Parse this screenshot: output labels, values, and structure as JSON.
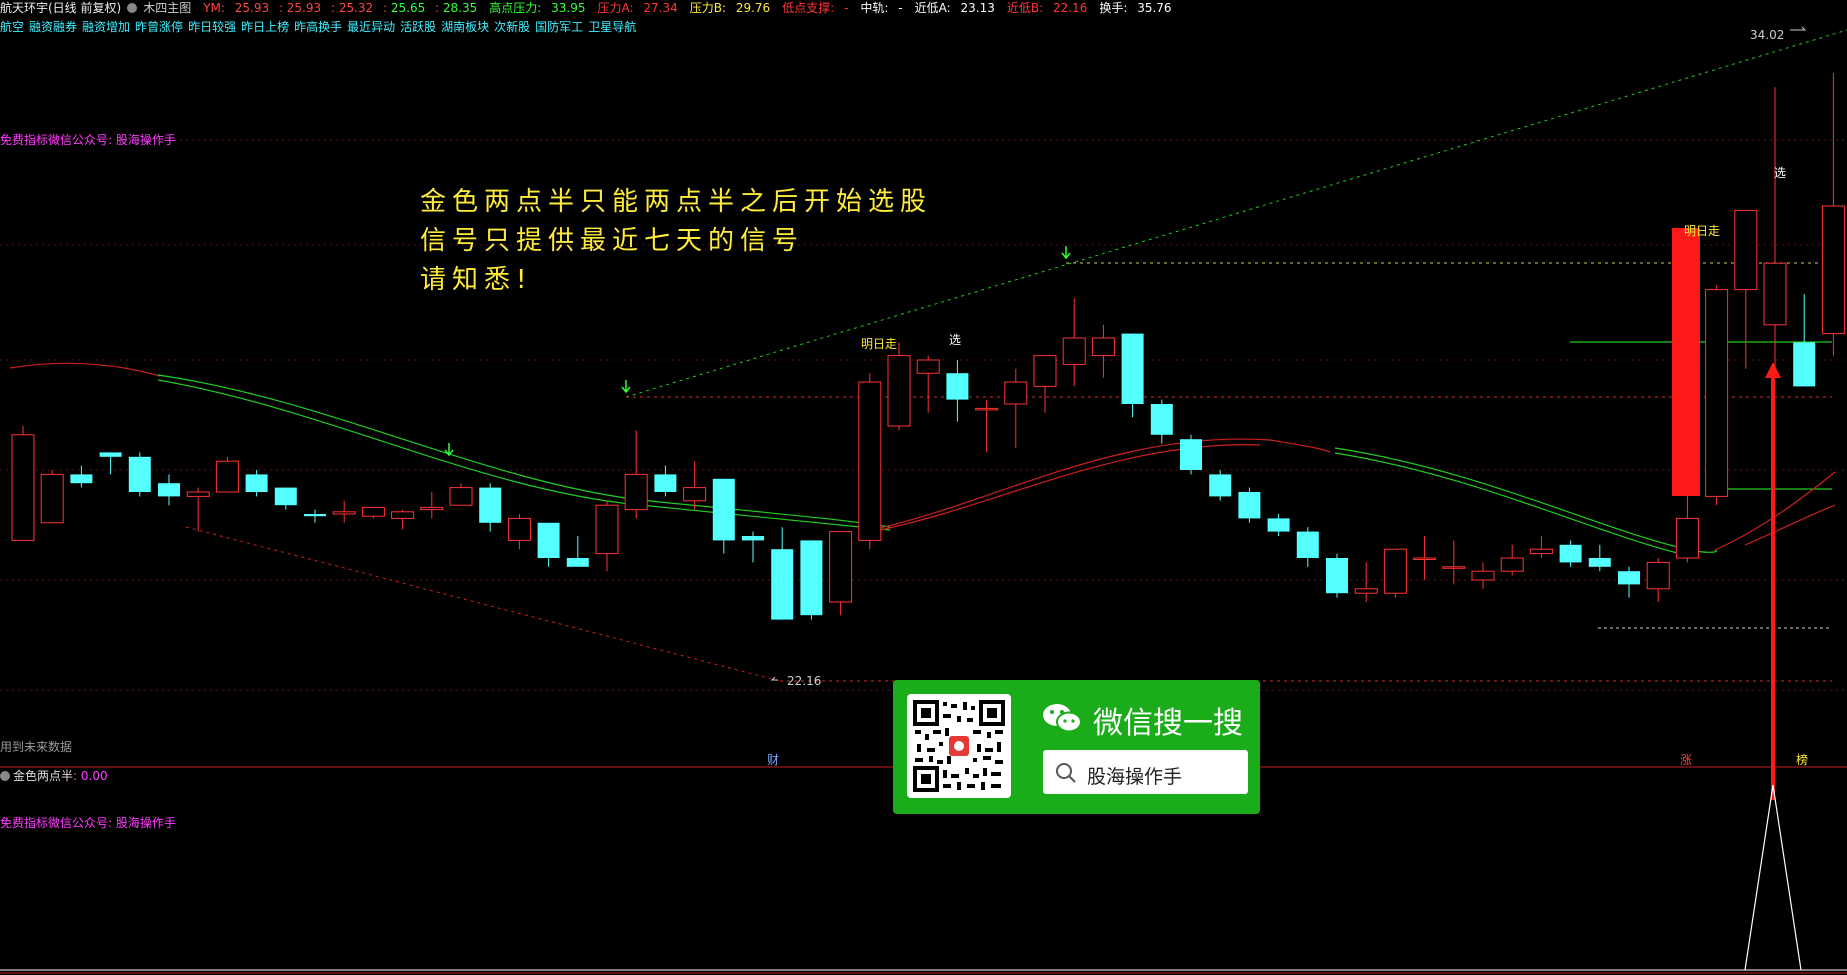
{
  "header": {
    "stock": "航天环宇(日线 前复权)",
    "indicator": "木四主图",
    "ym_label": "YM:",
    "ym_values": [
      "25.93",
      "25.93",
      "25.32",
      "25.65",
      "28.35"
    ],
    "items": [
      {
        "label": "高点压力:",
        "value": "33.95",
        "color": "#33ff33"
      },
      {
        "label": "压力A:",
        "value": "27.34",
        "color": "#ff3333"
      },
      {
        "label": "压力B:",
        "value": "29.76",
        "color": "#ffeb3b"
      },
      {
        "label": "低点支撑:",
        "value": "-",
        "color": "#ff3333"
      },
      {
        "label": "中轨:",
        "value": "-",
        "color": "#ffffff"
      },
      {
        "label": "近低A:",
        "value": "23.13",
        "color": "#ffffff"
      },
      {
        "label": "近低B:",
        "value": "22.16",
        "color": "#ff3333"
      },
      {
        "label": "换手:",
        "value": "35.76",
        "color": "#ffffff"
      }
    ]
  },
  "tags": [
    "航空",
    "融资融券",
    "融资增加",
    "昨曾涨停",
    "昨日较强",
    "昨日上榜",
    "昨高换手",
    "最近异动",
    "活跃股",
    "湖南板块",
    "次新股",
    "国防军工",
    "卫星导航"
  ],
  "promo_top": "免费指标微信公众号: 股海操作手",
  "promo_bottom": "免费指标微信公众号: 股海操作手",
  "notice": [
    "金色两点半只能两点半之后开始选股",
    "信号只提供最近七天的信号",
    "请知悉!"
  ],
  "future_note": "用到未来数据",
  "sub_indicator": {
    "name": "金色两点半",
    "value": ": 0.00"
  },
  "markers": {
    "tomorrow1": "明日走",
    "tomorrow2": "明日走",
    "select1": "选",
    "select2": "选",
    "price_high": "34.02",
    "price_low": "22.16",
    "cai": "财",
    "zhang": "涨",
    "bang": "榜"
  },
  "wechat": {
    "title": "微信搜一搜",
    "search_text": "股海操作手"
  },
  "chart_data": {
    "type": "candlestick",
    "y_range": [
      20.0,
      35.0
    ],
    "candles": [
      {
        "o": 23.4,
        "h": 26.0,
        "l": 24.8,
        "c": 25.8
      },
      {
        "o": 23.8,
        "h": 25.0,
        "l": 24.7,
        "c": 24.9
      },
      {
        "o": 24.9,
        "h": 25.1,
        "l": 24.6,
        "c": 24.7
      },
      {
        "o": 25.4,
        "h": 25.4,
        "l": 24.9,
        "c": 25.3
      },
      {
        "o": 25.3,
        "h": 25.4,
        "l": 24.4,
        "c": 24.5
      },
      {
        "o": 24.7,
        "h": 24.9,
        "l": 24.2,
        "c": 24.4
      },
      {
        "o": 24.4,
        "h": 24.6,
        "l": 23.6,
        "c": 24.5
      },
      {
        "o": 24.5,
        "h": 25.3,
        "l": 24.5,
        "c": 25.2
      },
      {
        "o": 24.9,
        "h": 25.0,
        "l": 24.4,
        "c": 24.5
      },
      {
        "o": 24.6,
        "h": 24.6,
        "l": 24.1,
        "c": 24.2
      },
      {
        "o": 24.0,
        "h": 24.1,
        "l": 23.8,
        "c": 23.95
      },
      {
        "o": 24.0,
        "h": 24.3,
        "l": 23.8,
        "c": 24.05
      },
      {
        "o": 23.95,
        "h": 24.15,
        "l": 23.9,
        "c": 24.15
      },
      {
        "o": 23.9,
        "h": 24.1,
        "l": 23.65,
        "c": 24.05
      },
      {
        "o": 24.1,
        "h": 24.5,
        "l": 23.9,
        "c": 24.15
      },
      {
        "o": 24.2,
        "h": 24.7,
        "l": 24.2,
        "c": 24.6
      },
      {
        "o": 24.6,
        "h": 24.7,
        "l": 23.6,
        "c": 23.8
      },
      {
        "o": 23.4,
        "h": 24.0,
        "l": 23.2,
        "c": 23.9
      },
      {
        "o": 23.8,
        "h": 23.8,
        "l": 22.8,
        "c": 23.0
      },
      {
        "o": 23.0,
        "h": 23.5,
        "l": 22.8,
        "c": 22.8
      },
      {
        "o": 23.1,
        "h": 24.3,
        "l": 22.7,
        "c": 24.2
      },
      {
        "o": 24.1,
        "h": 25.9,
        "l": 23.9,
        "c": 24.9
      },
      {
        "o": 24.9,
        "h": 25.1,
        "l": 24.4,
        "c": 24.5
      },
      {
        "o": 24.3,
        "h": 25.2,
        "l": 24.1,
        "c": 24.6
      },
      {
        "o": 24.8,
        "h": 24.8,
        "l": 23.1,
        "c": 23.4
      },
      {
        "o": 23.5,
        "h": 23.6,
        "l": 22.9,
        "c": 23.4
      },
      {
        "o": 23.2,
        "h": 23.7,
        "l": 22.2,
        "c": 21.6
      },
      {
        "o": 23.4,
        "h": 23.4,
        "l": 21.6,
        "c": 21.7
      },
      {
        "o": 22.0,
        "h": 23.6,
        "l": 21.7,
        "c": 23.6
      },
      {
        "o": 23.4,
        "h": 27.2,
        "l": 23.2,
        "c": 27.0
      },
      {
        "o": 26.0,
        "h": 27.9,
        "l": 25.9,
        "c": 27.6
      },
      {
        "o": 27.2,
        "h": 27.6,
        "l": 26.3,
        "c": 27.5
      },
      {
        "o": 27.2,
        "h": 27.5,
        "l": 26.1,
        "c": 26.6
      },
      {
        "o": 26.4,
        "h": 26.6,
        "l": 25.4,
        "c": 26.4
      },
      {
        "o": 26.5,
        "h": 27.3,
        "l": 25.5,
        "c": 27.0
      },
      {
        "o": 26.9,
        "h": 27.6,
        "l": 26.3,
        "c": 27.6
      },
      {
        "o": 27.4,
        "h": 28.9,
        "l": 26.9,
        "c": 28.0
      },
      {
        "o": 27.6,
        "h": 28.3,
        "l": 27.1,
        "c": 28.0
      },
      {
        "o": 28.1,
        "h": 28.1,
        "l": 26.2,
        "c": 26.5
      },
      {
        "o": 26.5,
        "h": 26.6,
        "l": 25.6,
        "c": 25.8
      },
      {
        "o": 25.7,
        "h": 25.8,
        "l": 24.9,
        "c": 25.0
      },
      {
        "o": 24.9,
        "h": 25.0,
        "l": 24.3,
        "c": 24.4
      },
      {
        "o": 24.5,
        "h": 24.6,
        "l": 23.8,
        "c": 23.9
      },
      {
        "o": 23.9,
        "h": 24.0,
        "l": 23.5,
        "c": 23.6
      },
      {
        "o": 23.6,
        "h": 23.7,
        "l": 22.8,
        "c": 23.0
      },
      {
        "o": 23.0,
        "h": 23.1,
        "l": 22.1,
        "c": 22.2
      },
      {
        "o": 22.2,
        "h": 22.9,
        "l": 22.0,
        "c": 22.3
      },
      {
        "o": 22.2,
        "h": 23.2,
        "l": 22.1,
        "c": 23.2
      },
      {
        "o": 23.0,
        "h": 23.5,
        "l": 22.5,
        "c": 23.0
      },
      {
        "o": 22.8,
        "h": 23.4,
        "l": 22.4,
        "c": 22.8
      },
      {
        "o": 22.5,
        "h": 22.9,
        "l": 22.3,
        "c": 22.7
      },
      {
        "o": 22.7,
        "h": 23.3,
        "l": 22.6,
        "c": 23.0
      },
      {
        "o": 23.1,
        "h": 23.5,
        "l": 23.0,
        "c": 23.2
      },
      {
        "o": 23.3,
        "h": 23.4,
        "l": 22.8,
        "c": 22.9
      },
      {
        "o": 23.0,
        "h": 23.3,
        "l": 22.7,
        "c": 22.8
      },
      {
        "o": 22.7,
        "h": 22.8,
        "l": 22.1,
        "c": 22.4
      },
      {
        "o": 22.3,
        "h": 23.0,
        "l": 22.0,
        "c": 22.9
      },
      {
        "o": 23.0,
        "h": 24.7,
        "l": 22.9,
        "c": 23.9
      },
      {
        "o": 24.4,
        "h": 29.2,
        "l": 24.2,
        "c": 29.1
      },
      {
        "o": 29.1,
        "h": 30.8,
        "l": 27.3,
        "c": 30.9
      },
      {
        "o": 28.3,
        "h": 33.7,
        "l": 27.1,
        "c": 29.7
      },
      {
        "o": 27.9,
        "h": 29.0,
        "l": 26.9,
        "c": 26.9
      },
      {
        "o": 28.1,
        "h": 34.02,
        "l": 27.6,
        "c": 31.0
      },
      {
        "o": 29.4,
        "h": 31.6,
        "l": 28.9,
        "c": 29.8
      }
    ]
  }
}
